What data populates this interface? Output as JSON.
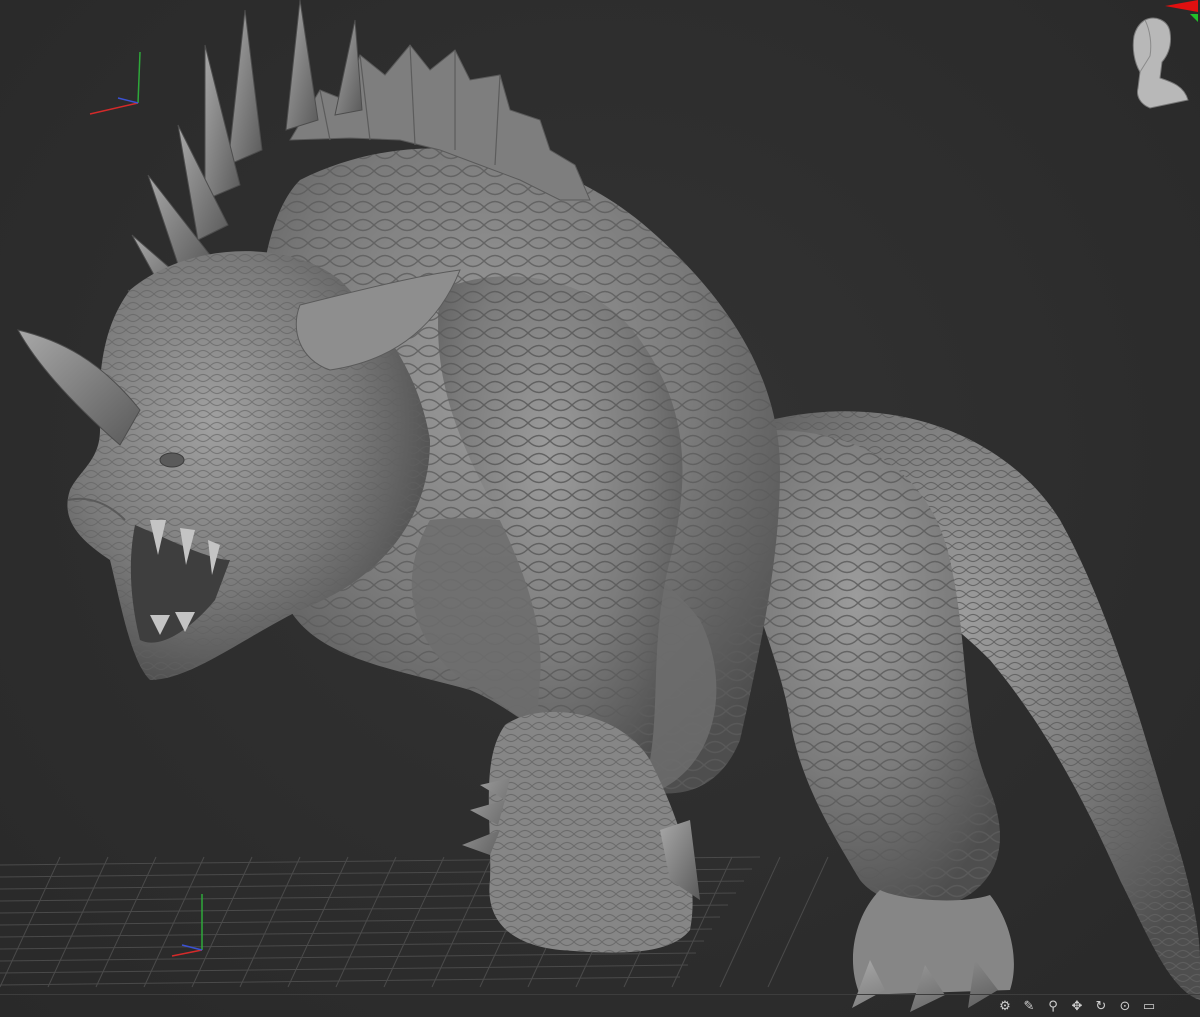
{
  "app": {
    "name": "",
    "viewport_label": ""
  },
  "scene": {
    "model_name": "",
    "background_color": "#2e2e2e",
    "model_color": "#8a8a8a",
    "grid_color": "#4a4a4a"
  },
  "axes": {
    "x_color": "#d42a2a",
    "y_color": "#2ea83a",
    "z_color": "#3b52d4"
  },
  "navigator": {
    "icon": "head-navigator-icon",
    "x_color": "#e01010",
    "y_color": "#22c02a"
  },
  "toolbar": {
    "icons": [
      {
        "name": "gear-icon",
        "glyph": "⚙"
      },
      {
        "name": "brush-icon",
        "glyph": "✎"
      },
      {
        "name": "pin-icon",
        "glyph": "⚲"
      },
      {
        "name": "move-icon",
        "glyph": "✥"
      },
      {
        "name": "rotate-icon",
        "glyph": "↻"
      },
      {
        "name": "zoom-icon",
        "glyph": "⊙"
      },
      {
        "name": "frame-icon",
        "glyph": "▭"
      }
    ]
  }
}
